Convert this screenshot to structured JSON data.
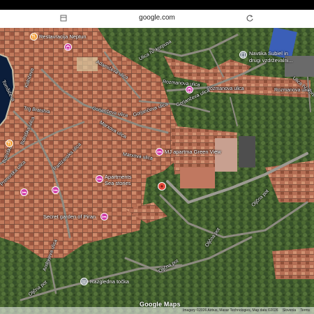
{
  "browser": {
    "url": "google.com"
  },
  "map": {
    "logo": "Google Maps",
    "attribution": "Imagery ©2026 Airbus, Maxar Technologies, Map data ©2026",
    "region": "Slovenia",
    "terms": "Terms"
  },
  "places": [
    "Restavracija Neptun",
    "Navtika Subiel in",
    "drugi vzdrževalni...",
    "MJ apartma Green View",
    "Apartments",
    "Sea stories",
    "Secret garden of Piran",
    "Razgledna točka"
  ],
  "streets": [
    "Kidričeva",
    "Tomšičeva",
    "Trg Bratstva",
    "Adamičeva ulica",
    "Ulica IV. korpusa",
    "Rozmanova ulica",
    "Rozmanova ulica",
    "Rozmanova ulica",
    "Ulica IV. korpusa",
    "Gorjančeva ulica",
    "Gorjančeva ulica",
    "Gorjančeva ulica",
    "Marxova ulica",
    "Marxova ulica",
    "Partizanska ulica",
    "Primorska ulica",
    "Bolniška ulica",
    "Bolniška",
    "Andrejeva ulica",
    "Oljčna pot",
    "Oljčna pot",
    "Oljčna pot",
    "Oljčna pot"
  ]
}
